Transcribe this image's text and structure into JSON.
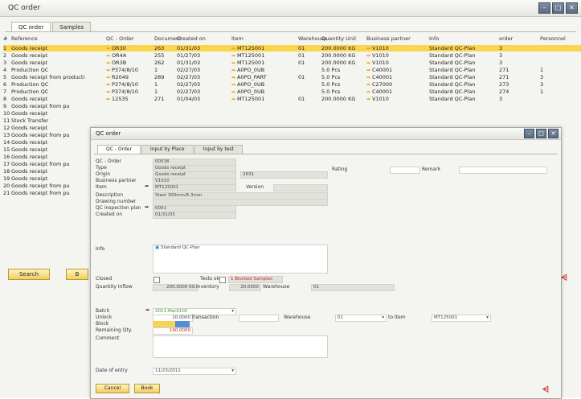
{
  "main": {
    "title": "QC order",
    "tabs": [
      "QC order",
      "Samples"
    ],
    "columns": [
      "#",
      "Reference",
      "QC - Order",
      "Document",
      "Created on",
      "Item",
      "Warehouse",
      "Quantity Unit",
      "Business partner",
      "Info",
      "order",
      "Personnel"
    ],
    "rows": [
      [
        "1",
        "Goods receipt",
        "OR30",
        "263",
        "01/31/03",
        "MT125001",
        "01",
        "200.0000 KG",
        "V1010",
        "Standard QC-Plan",
        "3",
        ""
      ],
      [
        "2",
        "Goods receipt",
        "OR4A",
        "255",
        "01/27/03",
        "MT125001",
        "01",
        "200.0000 KG",
        "V1010",
        "Standard QC-Plan",
        "3",
        ""
      ],
      [
        "3",
        "Goods receipt",
        "OR3B",
        "262",
        "01/31/03",
        "MT125001",
        "01",
        "200.0000 KG",
        "V1010",
        "Standard QC-Plan",
        "3",
        ""
      ],
      [
        "4",
        "Production QC",
        "P374/8/10",
        "1",
        "02/27/03",
        "A0PO_0UB",
        "",
        "5.0 Pcs",
        "C40001",
        "Standard QC-Plan",
        "271",
        "1"
      ],
      [
        "5",
        "Goods receipt from producti",
        "R2049",
        "289",
        "02/27/03",
        "A0PO_PART",
        "01",
        "5.0 Pcs",
        "C40001",
        "Standard QC-Plan",
        "271",
        "3"
      ],
      [
        "6",
        "Production QC",
        "P374/8/10",
        "1",
        "02/27/03",
        "A0PO_0UB",
        "",
        "5.0 Pcs",
        "C27000",
        "Standard QC-Plan",
        "273",
        "3"
      ],
      [
        "7",
        "Production QC",
        "P374/8/10",
        "1",
        "02/27/03",
        "A0PO_0UB",
        "",
        "5.0 Pcs",
        "C40001",
        "Standard QC-Plan",
        "274",
        "1"
      ],
      [
        "8",
        "Goods receipt",
        "12535",
        "271",
        "01/04/03",
        "MT125001",
        "01",
        "200.0000 KG",
        "V1010",
        "Standard QC-Plan",
        "3",
        ""
      ],
      [
        "9",
        "Goods receipt from pu",
        "",
        "",
        "",
        "",
        "",
        "",
        "",
        "",
        "",
        ""
      ],
      [
        "10",
        "Goods receipt",
        "",
        "",
        "",
        "",
        "",
        "",
        "",
        "",
        "",
        ""
      ],
      [
        "11",
        "Stock Transfer",
        "",
        "",
        "",
        "",
        "",
        "",
        "",
        "",
        "",
        ""
      ],
      [
        "12",
        "Goods receipt",
        "",
        "",
        "",
        "",
        "",
        "",
        "",
        "",
        "",
        ""
      ],
      [
        "13",
        "Goods receipt from pu",
        "",
        "",
        "",
        "",
        "",
        "",
        "",
        "",
        "",
        ""
      ],
      [
        "14",
        "Goods receipt",
        "",
        "",
        "",
        "",
        "",
        "",
        "",
        "",
        "",
        ""
      ],
      [
        "15",
        "Goods receipt",
        "",
        "",
        "",
        "",
        "",
        "",
        "",
        "",
        "",
        ""
      ],
      [
        "16",
        "Goods receipt",
        "",
        "",
        "",
        "",
        "",
        "",
        "",
        "",
        "",
        ""
      ],
      [
        "17",
        "Goods receipt from pu",
        "",
        "",
        "",
        "",
        "",
        "",
        "",
        "",
        "",
        ""
      ],
      [
        "18",
        "Goods receipt",
        "",
        "",
        "",
        "",
        "",
        "",
        "",
        "",
        "",
        ""
      ],
      [
        "19",
        "Goods receipt",
        "",
        "",
        "",
        "",
        "",
        "",
        "",
        "",
        "",
        ""
      ],
      [
        "20",
        "Goods receipt from pu",
        "",
        "",
        "",
        "",
        "",
        "",
        "",
        "",
        "",
        ""
      ],
      [
        "21",
        "Goods receipt from pu",
        "",
        "",
        "",
        "",
        "",
        "",
        "",
        "",
        "",
        ""
      ]
    ],
    "search_button": "Search",
    "second_button": "B"
  },
  "dialog": {
    "title": "QC order",
    "tabs": [
      "QC - Order",
      "Input by Place",
      "Input by test"
    ],
    "labels": {
      "qc_order": "QC - Order",
      "type": "Type",
      "origin": "Origin",
      "business_partner": "Business partner",
      "item": "Item",
      "version": "Version",
      "description": "Description",
      "drawing_number": "Drawing number",
      "qc_plan": "QC inspection plan",
      "created_on": "Created on",
      "rating": "Rating",
      "remark": "Remark",
      "info": "Info",
      "closed": "Closed",
      "tests_ok": "Tests ok",
      "quantity_inflow": "Quantity Inflow",
      "inventory": "Inventory",
      "warehouse": "Warehouse",
      "batch": "Batch",
      "unlock": "Unlock",
      "transaction": "Transaction",
      "warehouse2": "Warehouse",
      "to_item": "to Item",
      "block": "Block",
      "remaining_qty": "Remaining Qty.",
      "comment": "Comment",
      "date_of_entry": "Date of entry"
    },
    "values": {
      "qc_order": "00538",
      "type": "Goods receipt",
      "origin": "Goods receipt",
      "origin_num": "2631",
      "business_partner": "V1010",
      "item": "MT125001",
      "description": "Steel 300mm/6.3mm",
      "qc_plan": "0001",
      "created_on": "01/31/03",
      "info": "Standard QC-Plan",
      "blocked_samples": "1 Blocked Samples",
      "quantity_inflow": "200.0000 KG",
      "inventory": "20.0000",
      "warehouse": "01",
      "batch": "2011-Mar0100",
      "unlock": "10.0000",
      "warehouse2": "01",
      "to_item": "MT125001",
      "remaining_qty": "190.0000",
      "date_of_entry": "11/23/2011"
    },
    "cancel_button": "Cancel",
    "book_button": "Book"
  },
  "colors": {
    "selected_row": "#fbd54d",
    "button_gold": "#f1cf5e",
    "link_arrow": "#e8a000"
  }
}
